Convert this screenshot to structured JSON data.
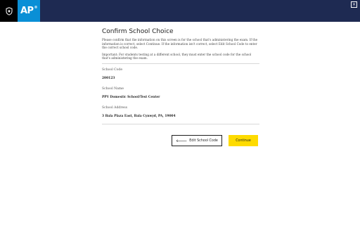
{
  "header": {
    "logo_text": "AP",
    "logo_mark": "®",
    "close_label": "×",
    "colors": {
      "bar": "#1e2a52",
      "ap_logo": "#0a8fd6",
      "cb_logo": "#000000"
    }
  },
  "page": {
    "title": "Confirm School Choice",
    "intro": "Please confirm that the information on this screen is for the school that's administering the exam. If the information is correct, select Continue. If the information isn't correct, select Edit School Code to enter the correct school code.",
    "important": "Important: For students testing at a different school, they must enter the school code for the school that's administering the exam."
  },
  "fields": [
    {
      "label": "School Code",
      "value": "200123"
    },
    {
      "label": "School Name",
      "value": "PPV Domestic School/Test Center"
    },
    {
      "label": "School Address",
      "value": "3 Bala Plaza East, Bala Cynwyd, PA, 19004"
    }
  ],
  "actions": {
    "edit_label": "Edit School Code",
    "edit_icon": "arrow-left-icon",
    "continue_label": "Continue",
    "continue_color": "#fedb00"
  }
}
